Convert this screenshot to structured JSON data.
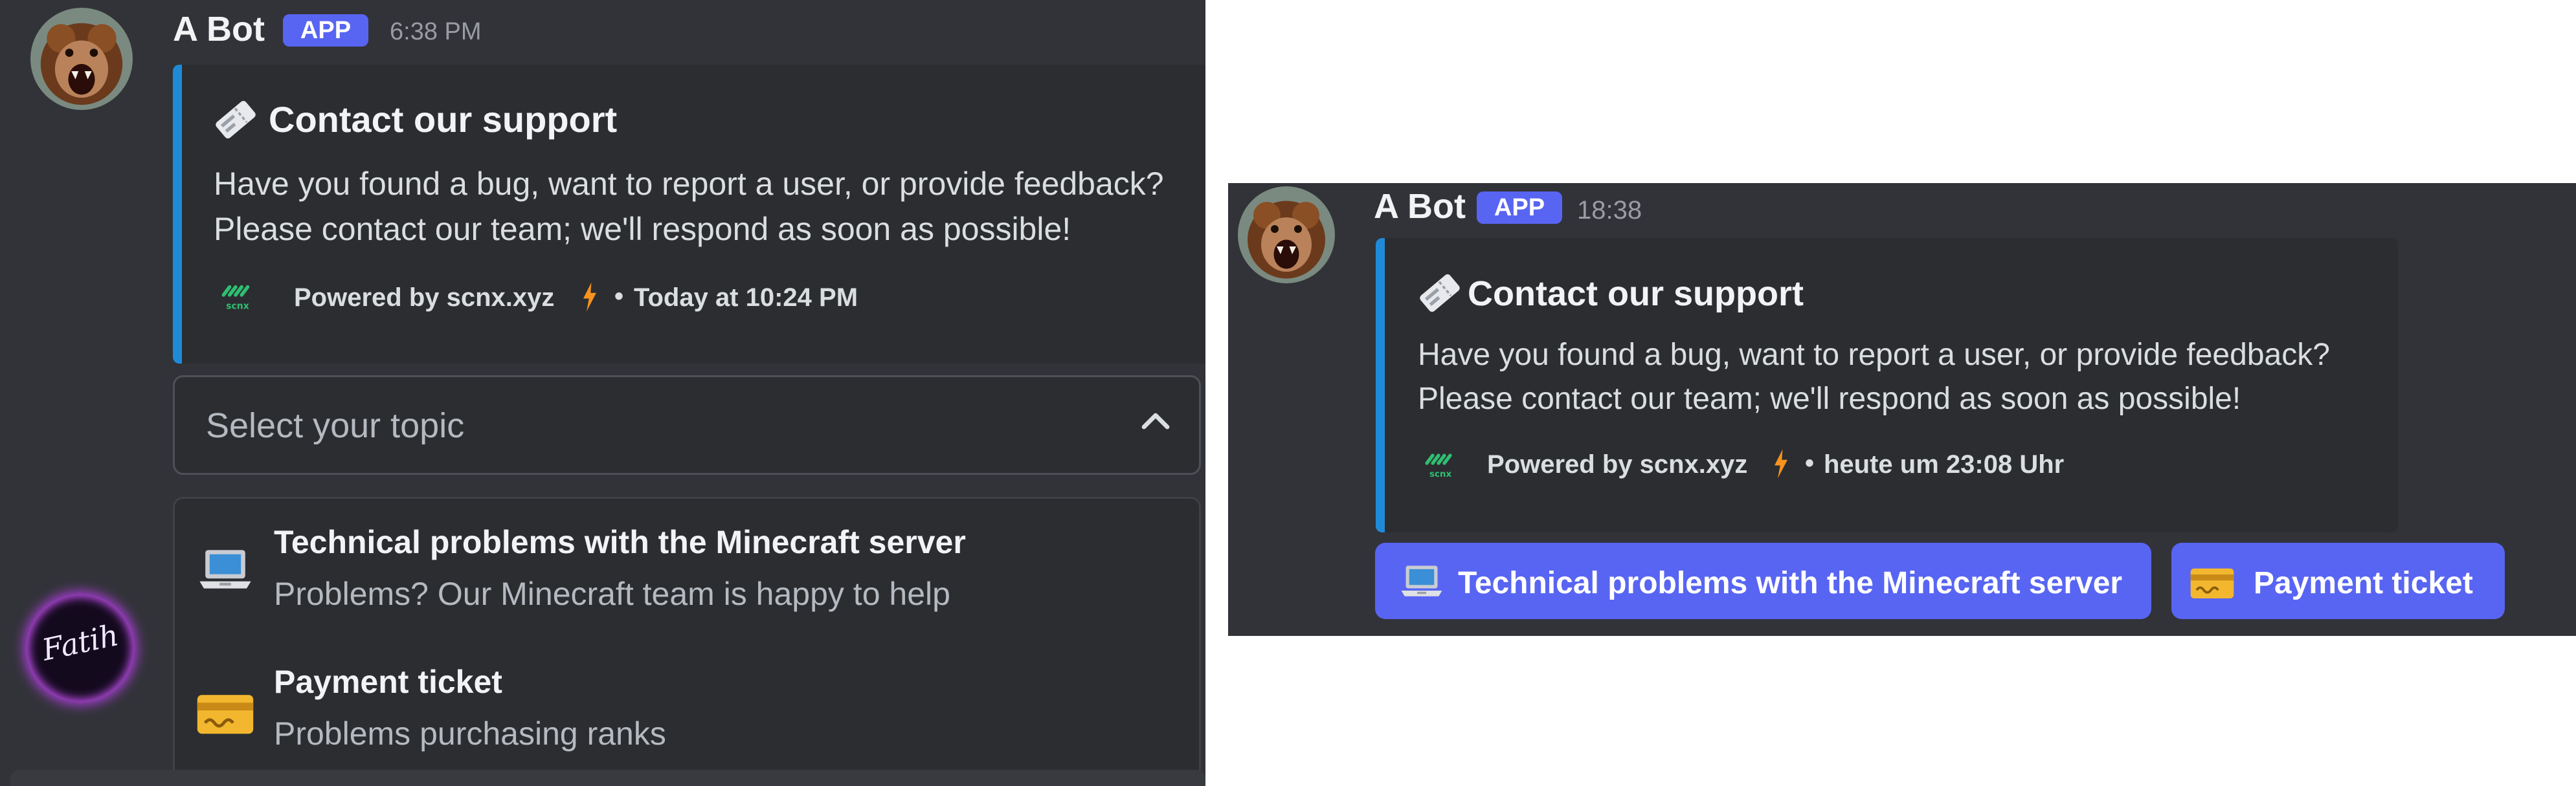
{
  "colors": {
    "background": "#323339",
    "embed_background": "#2b2d31",
    "embed_accent": "#1f8bd8",
    "blurple": "#5865f2",
    "text_muted": "#9a9ca3"
  },
  "left": {
    "message": {
      "username": "A Bot",
      "badge": "APP",
      "timestamp": "6:38 PM"
    },
    "embed": {
      "title_icon": "ticket-icon",
      "title": "Contact our support",
      "description_line1": "Have you found a bug, want to report a user, or provide feedback?",
      "description_line2": "Please contact our team; we'll respond as soon as possible!",
      "footer_text": "Powered by scnx.xyz",
      "footer_separator": "•",
      "footer_time": "Today at 10:24 PM",
      "footer_logo_text": "scnx"
    },
    "select": {
      "placeholder": "Select your topic",
      "chevron_icon": "chevron-up-icon"
    },
    "options": [
      {
        "icon": "laptop-icon",
        "title": "Technical problems with the Minecraft server",
        "description": "Problems? Our Minecraft team is happy to help"
      },
      {
        "icon": "credit-card-icon",
        "title": "Payment ticket",
        "description": "Problems purchasing ranks"
      }
    ],
    "user_avatar_text": "Fatih"
  },
  "right": {
    "message": {
      "username": "A Bot",
      "badge": "APP",
      "timestamp": "18:38"
    },
    "embed": {
      "title_icon": "ticket-icon",
      "title": "Contact our support",
      "description_line1": "Have you found a bug, want to report a user, or provide feedback?",
      "description_line2": "Please contact our team; we'll respond as soon as possible!",
      "footer_text": "Powered by scnx.xyz",
      "footer_separator": "•",
      "footer_time": "heute um 23:08 Uhr",
      "footer_logo_text": "scnx"
    },
    "buttons": [
      {
        "icon": "laptop-icon",
        "label": "Technical problems with the Minecraft server"
      },
      {
        "icon": "credit-card-icon",
        "label": "Payment ticket"
      }
    ]
  }
}
